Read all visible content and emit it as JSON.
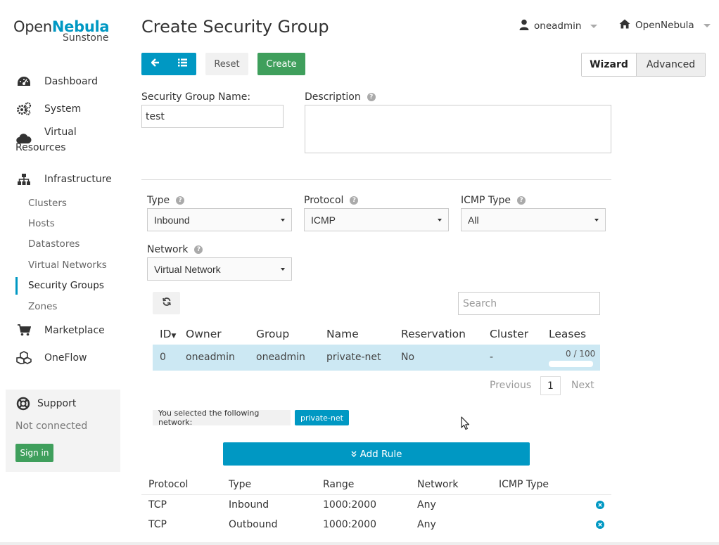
{
  "app": {
    "logo_open": "Open",
    "logo_nebula": "Nebula",
    "logo_sub": "Sunstone",
    "brand_color": "#0098c3",
    "success_color": "#3f9f5c"
  },
  "sidebar": {
    "items": [
      {
        "label": "Dashboard",
        "icon": "dashboard-icon"
      },
      {
        "label": "System",
        "icon": "gears-icon"
      },
      {
        "label_line1": "Virtual",
        "label_line2": "Resources",
        "icon": "cloud-icon"
      },
      {
        "label": "Infrastructure",
        "icon": "sitemap-icon"
      }
    ],
    "infrastructure_sub": [
      "Clusters",
      "Hosts",
      "Datastores",
      "Virtual Networks",
      "Security Groups",
      "Zones"
    ],
    "active_sub": "Security Groups",
    "marketplace": "Marketplace",
    "oneflow": "OneFlow",
    "support": {
      "title": "Support",
      "status": "Not connected",
      "sign_in": "Sign in"
    }
  },
  "header": {
    "title": "Create Security Group",
    "user": "oneadmin",
    "zone": "OpenNebula"
  },
  "toolbar": {
    "reset": "Reset",
    "create": "Create",
    "wizard": "Wizard",
    "advanced": "Advanced"
  },
  "form": {
    "name_label": "Security Group Name:",
    "name_value": "test",
    "description_label": "Description",
    "description_value": "",
    "type_label": "Type",
    "type_value": "Inbound",
    "protocol_label": "Protocol",
    "protocol_value": "ICMP",
    "icmp_label": "ICMP Type",
    "icmp_value": "All",
    "network_label": "Network",
    "network_value": "Virtual Network"
  },
  "network_table": {
    "search_placeholder": "Search",
    "headers": [
      "ID",
      "Owner",
      "Group",
      "Name",
      "Reservation",
      "Cluster",
      "Leases"
    ],
    "rows": [
      {
        "id": "0",
        "owner": "oneadmin",
        "group": "oneadmin",
        "name": "private-net",
        "reservation": "No",
        "cluster": "-",
        "leases": "0 / 100"
      }
    ],
    "pagination": {
      "previous": "Previous",
      "page": "1",
      "next": "Next"
    },
    "selected_text": "You selected the following network:",
    "selected_value": "private-net"
  },
  "add_rule": "Add Rule",
  "rules_table": {
    "headers": [
      "Protocol",
      "Type",
      "Range",
      "Network",
      "ICMP Type"
    ],
    "rows": [
      {
        "protocol": "TCP",
        "type": "Inbound",
        "range": "1000:2000",
        "network": "Any",
        "icmp": ""
      },
      {
        "protocol": "TCP",
        "type": "Outbound",
        "range": "1000:2000",
        "network": "Any",
        "icmp": ""
      }
    ]
  }
}
